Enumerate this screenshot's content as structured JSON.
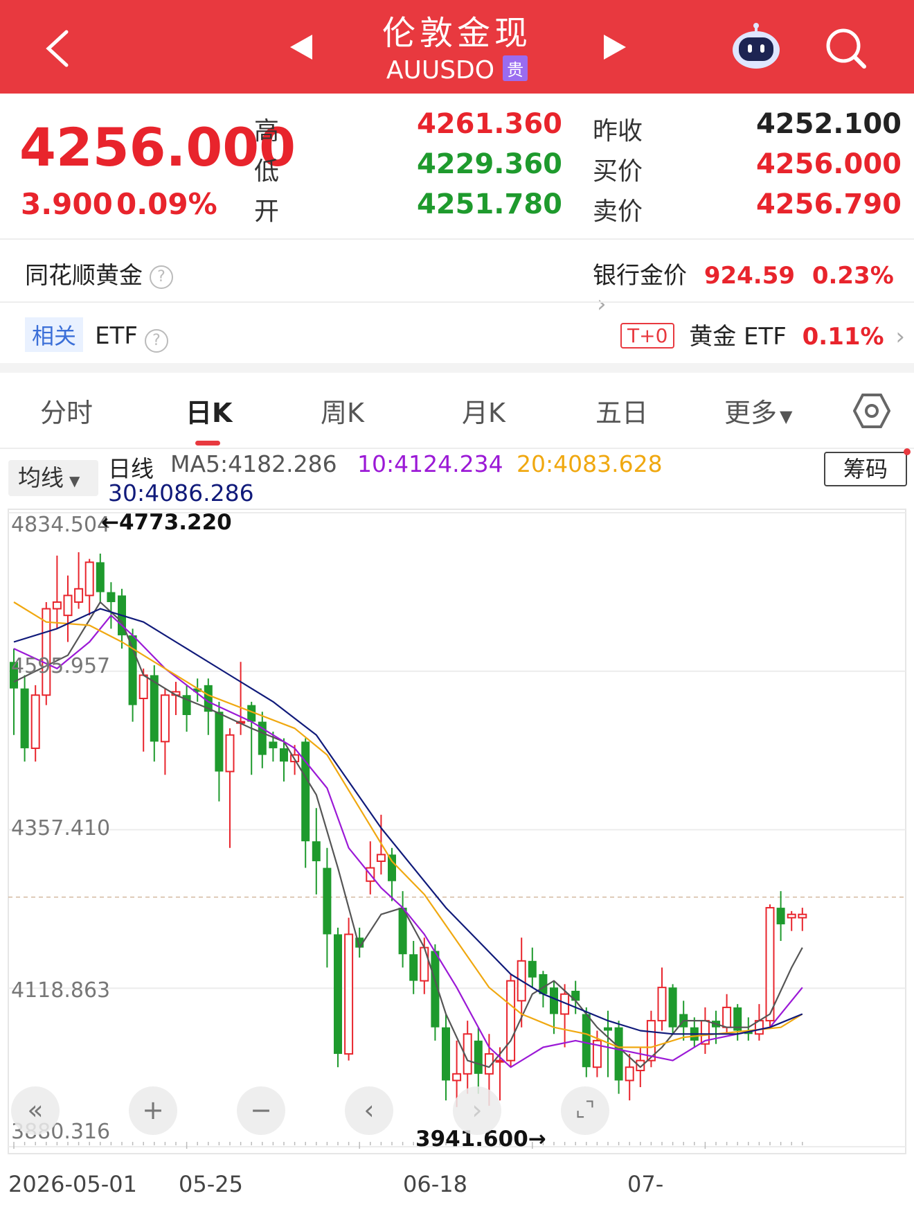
{
  "header": {
    "title": "伦敦金现",
    "code": "AUUSDO",
    "badge": "贵"
  },
  "quote": {
    "price": "4256.000",
    "change": "3.900",
    "change_pct": "0.09%",
    "high_label": "高",
    "high": "4261.360",
    "low_label": "低",
    "low": "4229.360",
    "open_label": "开",
    "open": "4251.780",
    "prev_close_label": "昨收",
    "prev_close": "4252.100",
    "bid_label": "买价",
    "bid": "4256.000",
    "ask_label": "卖价",
    "ask": "4256.790"
  },
  "gold_row": {
    "label": "同花顺黄金",
    "bank_label": "银行金价",
    "bank_value": "924.59",
    "bank_pct": "0.23%"
  },
  "etf_row": {
    "tag": "相关",
    "label": "ETF",
    "t0": "T+0",
    "etf_name": "黄金 ETF",
    "etf_pct": "0.11%"
  },
  "tabs": [
    "分时",
    "日K",
    "周K",
    "月K",
    "五日",
    "更多"
  ],
  "active_tab": "日K",
  "indicator": {
    "selector": "均线",
    "chips_button": "筹码",
    "line_label": "日线",
    "ma5": "MA5:4182.286",
    "ma10": "10:4124.234",
    "ma20": "20:4083.628",
    "ma30": "30:4086.286"
  },
  "colors": {
    "header_bg": "#e8393f",
    "up": "#e8242c",
    "down": "#1e9a2d",
    "ma5": "#555555",
    "ma10": "#9b19d6",
    "ma20": "#f0a810",
    "ma30": "#101a7a"
  },
  "chart_data": {
    "type": "candlestick",
    "y_ticks": [
      "4834.504",
      "4595.957",
      "4357.410",
      "4118.863",
      "3880.316"
    ],
    "ylim": [
      3880.316,
      4834.504
    ],
    "x_ticks": [
      "2026-05-01",
      "05-25",
      "06-18",
      "07-"
    ],
    "max_annotation": "4773.220",
    "min_annotation": "3941.600",
    "current_price": 4256.0,
    "candles": [
      [
        4610,
        4570,
        4630,
        4500
      ],
      [
        4570,
        4480,
        4590,
        4460
      ],
      [
        4480,
        4560,
        4575,
        4460
      ],
      [
        4560,
        4690,
        4700,
        4545
      ],
      [
        4690,
        4700,
        4770,
        4660
      ],
      [
        4680,
        4710,
        4740,
        4640
      ],
      [
        4700,
        4720,
        4775,
        4690
      ],
      [
        4710,
        4760,
        4765,
        4680
      ],
      [
        4760,
        4715,
        4773,
        4700
      ],
      [
        4715,
        4700,
        4730,
        4660
      ],
      [
        4710,
        4650,
        4720,
        4630
      ],
      [
        4650,
        4545,
        4660,
        4520
      ],
      [
        4555,
        4590,
        4600,
        4475
      ],
      [
        4590,
        4490,
        4605,
        4460
      ],
      [
        4490,
        4560,
        4570,
        4440
      ],
      [
        4560,
        4565,
        4580,
        4530
      ],
      [
        4560,
        4530,
        4575,
        4505
      ],
      [
        4570,
        4565,
        4585,
        4550
      ],
      [
        4575,
        4535,
        4585,
        4500
      ],
      [
        4535,
        4445,
        4550,
        4400
      ],
      [
        4445,
        4500,
        4510,
        4330
      ],
      [
        4520,
        4520,
        4610,
        4500
      ],
      [
        4545,
        4520,
        4550,
        4440
      ],
      [
        4520,
        4470,
        4535,
        4450
      ],
      [
        4490,
        4480,
        4505,
        4460
      ],
      [
        4480,
        4460,
        4495,
        4430
      ],
      [
        4460,
        4470,
        4485,
        4440
      ],
      [
        4490,
        4340,
        4495,
        4300
      ],
      [
        4340,
        4310,
        4390,
        4260
      ],
      [
        4300,
        4200,
        4330,
        4150
      ],
      [
        4200,
        4020,
        4210,
        4000
      ],
      [
        4020,
        4200,
        4225,
        4010
      ],
      [
        4195,
        4180,
        4210,
        4165
      ],
      [
        4280,
        4300,
        4340,
        4260
      ],
      [
        4310,
        4320,
        4380,
        4290
      ],
      [
        4320,
        4280,
        4330,
        4250
      ],
      [
        4240,
        4170,
        4265,
        4150
      ],
      [
        4170,
        4130,
        4190,
        4110
      ],
      [
        4130,
        4180,
        4195,
        4110
      ],
      [
        4175,
        4060,
        4185,
        4040
      ],
      [
        4060,
        3980,
        4080,
        3950
      ],
      [
        3980,
        3990,
        4040,
        3940
      ],
      [
        3990,
        4050,
        4070,
        3960
      ],
      [
        4040,
        3990,
        4060,
        3960
      ],
      [
        3990,
        4020,
        4050,
        3942
      ],
      [
        4010,
        4010,
        4030,
        3950
      ],
      [
        4010,
        4130,
        4140,
        4000
      ],
      [
        4100,
        4160,
        4195,
        4060
      ],
      [
        4160,
        4135,
        4180,
        4120
      ],
      [
        4140,
        4110,
        4145,
        4090
      ],
      [
        4120,
        4080,
        4130,
        4050
      ],
      [
        4080,
        4110,
        4125,
        4030
      ],
      [
        4115,
        4100,
        4130,
        4080
      ],
      [
        4080,
        4000,
        4090,
        3985
      ],
      [
        4000,
        4040,
        4055,
        3985
      ],
      [
        4060,
        4055,
        4085,
        3985
      ],
      [
        4060,
        3980,
        4070,
        3960
      ],
      [
        3980,
        4000,
        4020,
        3950
      ],
      [
        3995,
        4010,
        4030,
        3970
      ],
      [
        4010,
        4070,
        4085,
        4000
      ],
      [
        4070,
        4120,
        4150,
        4055
      ],
      [
        4120,
        4060,
        4125,
        4050
      ],
      [
        4080,
        4060,
        4100,
        4040
      ],
      [
        4060,
        4040,
        4075,
        4030
      ],
      [
        4035,
        4070,
        4090,
        4020
      ],
      [
        4070,
        4060,
        4085,
        4035
      ],
      [
        4060,
        4090,
        4110,
        4050
      ],
      [
        4090,
        4055,
        4095,
        4040
      ],
      [
        4055,
        4050,
        4075,
        4040
      ],
      [
        4050,
        4070,
        4095,
        4040
      ],
      [
        4070,
        4240,
        4245,
        4060
      ],
      [
        4240,
        4215,
        4265,
        4190
      ],
      [
        4225,
        4230,
        4235,
        4205
      ],
      [
        4225,
        4230,
        4240,
        4205
      ]
    ],
    "ma_lines": {
      "MA5": [
        [
          0,
          4580
        ],
        [
          5,
          4620
        ],
        [
          8,
          4700
        ],
        [
          10,
          4670
        ],
        [
          12,
          4590
        ],
        [
          15,
          4560
        ],
        [
          18,
          4540
        ],
        [
          22,
          4510
        ],
        [
          25,
          4490
        ],
        [
          28,
          4410
        ],
        [
          30,
          4300
        ],
        [
          32,
          4180
        ],
        [
          34,
          4230
        ],
        [
          36,
          4240
        ],
        [
          38,
          4180
        ],
        [
          40,
          4080
        ],
        [
          42,
          4010
        ],
        [
          44,
          4000
        ],
        [
          46,
          4040
        ],
        [
          48,
          4110
        ],
        [
          50,
          4130
        ],
        [
          52,
          4100
        ],
        [
          54,
          4060
        ],
        [
          56,
          4030
        ],
        [
          58,
          4000
        ],
        [
          60,
          4030
        ],
        [
          62,
          4070
        ],
        [
          64,
          4070
        ],
        [
          66,
          4060
        ],
        [
          68,
          4060
        ],
        [
          70,
          4080
        ],
        [
          72,
          4150
        ],
        [
          73,
          4180
        ]
      ],
      "MA10": [
        [
          0,
          4630
        ],
        [
          4,
          4600
        ],
        [
          7,
          4640
        ],
        [
          9,
          4680
        ],
        [
          11,
          4650
        ],
        [
          14,
          4600
        ],
        [
          18,
          4550
        ],
        [
          22,
          4520
        ],
        [
          26,
          4480
        ],
        [
          29,
          4420
        ],
        [
          31,
          4330
        ],
        [
          34,
          4270
        ],
        [
          36,
          4240
        ],
        [
          38,
          4200
        ],
        [
          41,
          4120
        ],
        [
          44,
          4030
        ],
        [
          46,
          4000
        ],
        [
          49,
          4030
        ],
        [
          52,
          4040
        ],
        [
          55,
          4030
        ],
        [
          58,
          4020
        ],
        [
          61,
          4010
        ],
        [
          64,
          4040
        ],
        [
          67,
          4050
        ],
        [
          70,
          4060
        ],
        [
          73,
          4120
        ]
      ],
      "MA20": [
        [
          0,
          4700
        ],
        [
          3,
          4670
        ],
        [
          7,
          4665
        ],
        [
          10,
          4640
        ],
        [
          14,
          4600
        ],
        [
          18,
          4560
        ],
        [
          22,
          4535
        ],
        [
          26,
          4510
        ],
        [
          29,
          4470
        ],
        [
          32,
          4390
        ],
        [
          35,
          4310
        ],
        [
          38,
          4260
        ],
        [
          41,
          4190
        ],
        [
          44,
          4120
        ],
        [
          47,
          4080
        ],
        [
          50,
          4060
        ],
        [
          53,
          4050
        ],
        [
          56,
          4030
        ],
        [
          59,
          4030
        ],
        [
          62,
          4045
        ],
        [
          65,
          4050
        ],
        [
          68,
          4055
        ],
        [
          71,
          4060
        ],
        [
          73,
          4080
        ]
      ],
      "MA30": [
        [
          0,
          4640
        ],
        [
          4,
          4660
        ],
        [
          8,
          4690
        ],
        [
          12,
          4670
        ],
        [
          16,
          4630
        ],
        [
          20,
          4590
        ],
        [
          24,
          4550
        ],
        [
          28,
          4500
        ],
        [
          31,
          4430
        ],
        [
          34,
          4360
        ],
        [
          37,
          4300
        ],
        [
          40,
          4240
        ],
        [
          43,
          4190
        ],
        [
          46,
          4140
        ],
        [
          49,
          4110
        ],
        [
          52,
          4090
        ],
        [
          55,
          4070
        ],
        [
          58,
          4055
        ],
        [
          61,
          4050
        ],
        [
          64,
          4050
        ],
        [
          67,
          4050
        ],
        [
          70,
          4060
        ],
        [
          73,
          4080
        ]
      ]
    }
  },
  "controls": {
    "rewind": "«",
    "zoom_in": "+",
    "zoom_out": "−",
    "prev": "‹",
    "next": "›",
    "fullscreen": "⌞⌝"
  }
}
